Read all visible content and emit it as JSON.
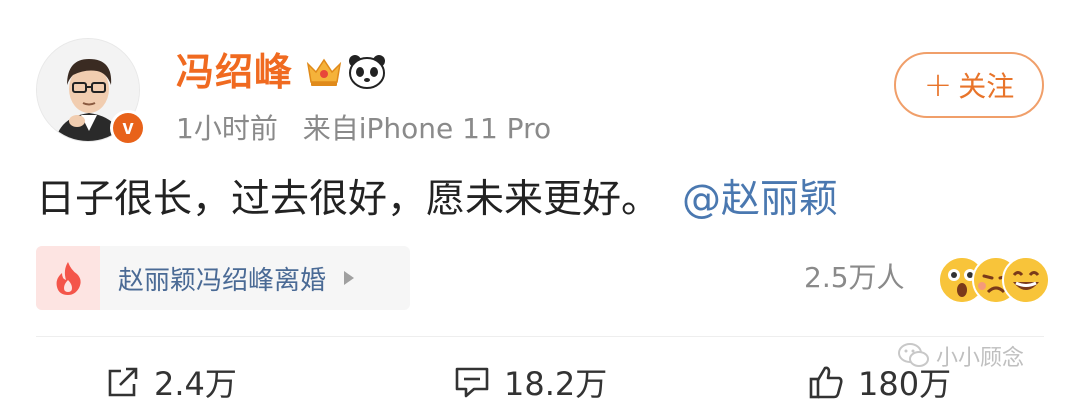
{
  "user": {
    "name": "冯绍峰",
    "time": "1小时前",
    "source": "来自iPhone 11 Pro",
    "verified_mark": "v"
  },
  "follow": {
    "plus": "+",
    "label": "关注"
  },
  "post": {
    "text": "日子很长，过去很好，愿未来更好。",
    "mention": "@赵丽颖"
  },
  "topic": {
    "title": "赵丽颖冯绍峰离婚",
    "people": "2.5万人"
  },
  "actions": {
    "repost_count": "2.4万",
    "comment_count": "18.2万",
    "like_count": "180万"
  },
  "watermark": {
    "text": "小小顾念"
  },
  "colors": {
    "name": "#f06a20",
    "mention": "#4a78b0",
    "follow_border": "#f09f6a",
    "verified": "#e8621a"
  }
}
